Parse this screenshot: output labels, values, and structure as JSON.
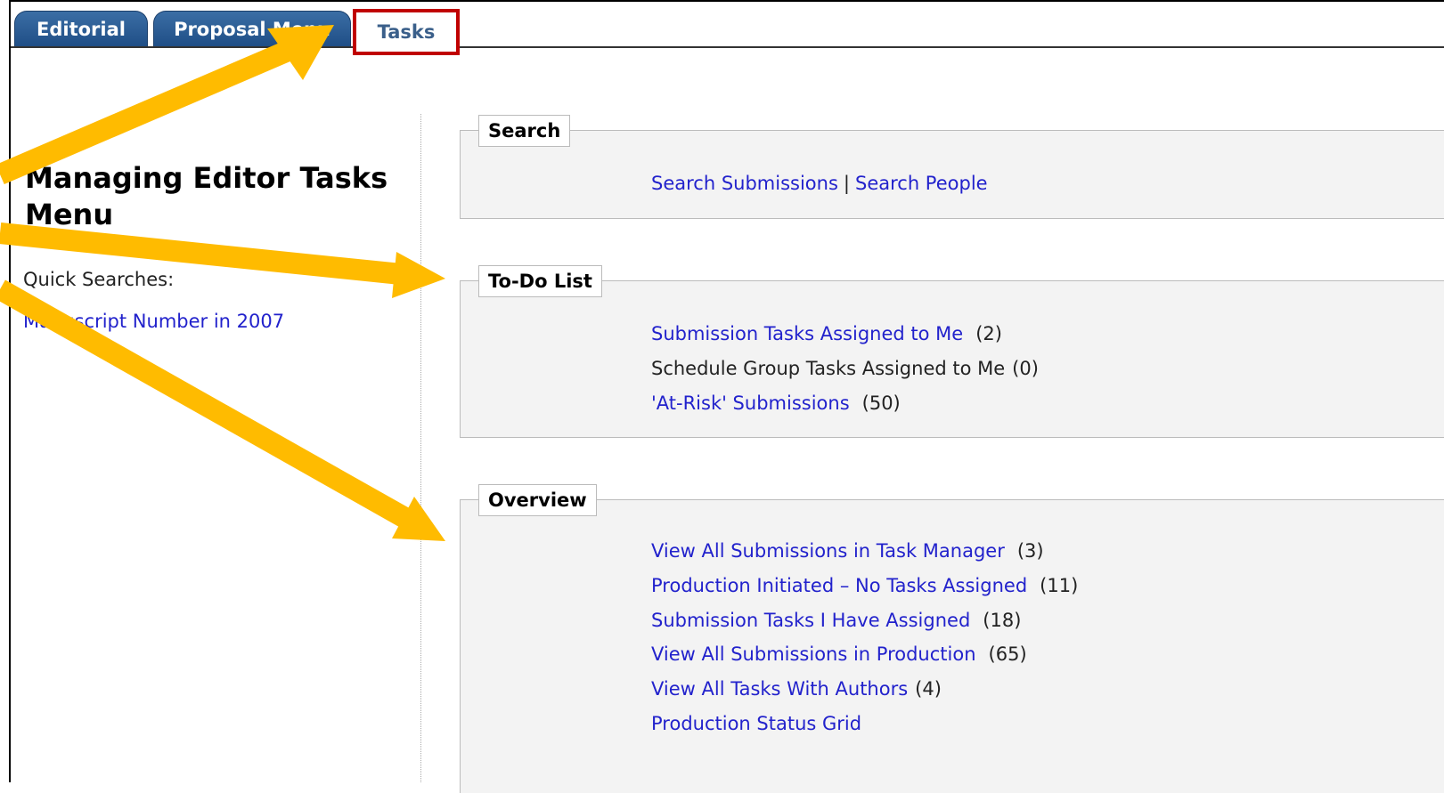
{
  "tabs": {
    "editorial": "Editorial",
    "proposal": "Proposal Menu",
    "tasks": "Tasks"
  },
  "sidebar": {
    "title": "Managing Editor Tasks Menu",
    "quick_label": "Quick Searches:",
    "quick_link": "Manuscript Number in 2007"
  },
  "search": {
    "legend": "Search",
    "submissions": "Search Submissions",
    "separator": "|",
    "people": "Search People"
  },
  "todo": {
    "legend": "To-Do List",
    "items": [
      {
        "label": "Submission Tasks Assigned to Me",
        "count": "(2)",
        "link": true
      },
      {
        "label": "Schedule Group Tasks Assigned to Me",
        "count": "(0)",
        "link": false
      },
      {
        "label": "'At-Risk' Submissions",
        "count": "(50)",
        "link": true
      }
    ]
  },
  "overview": {
    "legend": "Overview",
    "items": [
      {
        "label": "View All Submissions in Task Manager",
        "count": "(3)"
      },
      {
        "label": "Production Initiated – No Tasks Assigned",
        "count": "(11)"
      },
      {
        "label": "Submission Tasks I Have Assigned",
        "count": "(18)"
      },
      {
        "label": "View All Submissions in Production",
        "count": "(65)"
      },
      {
        "label": "View All Tasks With Authors",
        "count": "(4)"
      },
      {
        "label": "Production Status Grid",
        "count": ""
      }
    ]
  },
  "colors": {
    "tab_blue": "#2a5a94",
    "link": "#2222cc",
    "highlight_box": "#c00000",
    "arrow": "#ffbb00"
  }
}
